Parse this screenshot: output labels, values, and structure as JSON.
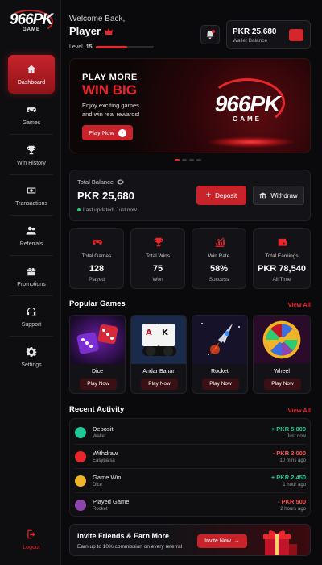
{
  "brand": {
    "logo_text": "966PK",
    "logo_sub": "GAME"
  },
  "sidebar": {
    "items": [
      {
        "label": "Dashboard",
        "icon": "home-icon",
        "active": true
      },
      {
        "label": "Games",
        "icon": "gamepad-icon"
      },
      {
        "label": "Win History",
        "icon": "trophy-icon"
      },
      {
        "label": "Transactions",
        "icon": "cash-icon"
      },
      {
        "label": "Referrals",
        "icon": "users-icon"
      },
      {
        "label": "Promotions",
        "icon": "gift-icon"
      },
      {
        "label": "Support",
        "icon": "headset-icon"
      },
      {
        "label": "Settings",
        "icon": "gear-icon"
      }
    ],
    "logout": "Logout"
  },
  "header": {
    "welcome": "Welcome Back,",
    "player": "Player",
    "level_label": "Level",
    "level": "15",
    "level_progress": 0.55,
    "wallet_amount": "PKR 25,680",
    "wallet_label": "Wallet Balance"
  },
  "banner": {
    "line1": "PLAY MORE",
    "line2": "WIN BIG",
    "desc1": "Enjoy exciting games",
    "desc2": "and win real rewards!",
    "button": "Play Now",
    "logo_text": "966PK",
    "logo_sub": "GAME"
  },
  "balance": {
    "title": "Total Balance",
    "value": "PKR 25,680",
    "updated": "Last updated: Just now",
    "deposit": "Deposit",
    "withdraw": "Withdraw"
  },
  "stats": [
    {
      "label": "Total Games",
      "value": "128",
      "sub": "Played",
      "icon": "gamepad-icon"
    },
    {
      "label": "Total Wins",
      "value": "75",
      "sub": "Won",
      "icon": "trophy-icon"
    },
    {
      "label": "Win Rate",
      "value": "58%",
      "sub": "Success",
      "icon": "chart-icon"
    },
    {
      "label": "Total Earnings",
      "value": "PKR 78,540",
      "sub": "All Time",
      "icon": "wallet-icon"
    }
  ],
  "popular": {
    "title": "Popular Games",
    "view_all": "View All",
    "games": [
      {
        "name": "Dice",
        "button": "Play Now"
      },
      {
        "name": "Andar Bahar",
        "button": "Play Now"
      },
      {
        "name": "Rocket",
        "button": "Play Now"
      },
      {
        "name": "Wheel",
        "button": "Play Now"
      }
    ]
  },
  "activity": {
    "title": "Recent Activity",
    "view_all": "View All",
    "rows": [
      {
        "name": "Deposit",
        "sub": "Wallet",
        "amount": "+ PKR 5,000",
        "time": "Just now",
        "color": "#20c997"
      },
      {
        "name": "Withdraw",
        "sub": "Easypaisa",
        "amount": "- PKR 3,000",
        "time": "10 mins ago",
        "color": "#e8262b"
      },
      {
        "name": "Game Win",
        "sub": "Dice",
        "amount": "+ PKR 2,450",
        "time": "1 hour ago",
        "color": "#f0b429"
      },
      {
        "name": "Played Game",
        "sub": "Rocket",
        "amount": "- PKR 500",
        "time": "2 hours ago",
        "color": "#8e44ad"
      }
    ]
  },
  "invite": {
    "title": "Invite Friends & Earn More",
    "sub": "Earn up to 10% commission on every referral",
    "button": "Invite Now"
  },
  "colors": {
    "accent": "#e8262b",
    "positive": "#20c997",
    "negative": "#ff4d4f",
    "bg": "#0a0a0c"
  }
}
